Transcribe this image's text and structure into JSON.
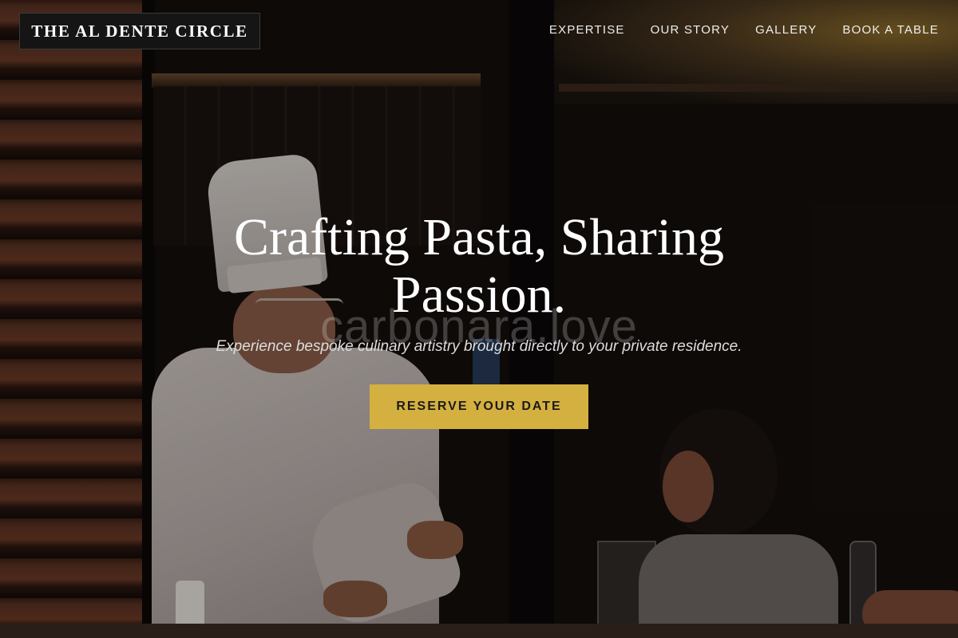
{
  "header": {
    "brand": "THE AL DENTE CIRCLE",
    "nav": [
      {
        "label": "EXPERTISE"
      },
      {
        "label": "OUR STORY"
      },
      {
        "label": "GALLERY"
      },
      {
        "label": "BOOK A TABLE"
      }
    ]
  },
  "hero": {
    "title_line1": "Crafting Pasta, Sharing",
    "title_line2": "Passion.",
    "watermark": "carbonara.love",
    "subtitle": "Experience bespoke culinary artistry brought directly to your private residence.",
    "cta_label": "RESERVE YOUR DATE"
  },
  "colors": {
    "accent": "#d4b040",
    "brand_bg": "#151515",
    "text": "#ffffff"
  }
}
